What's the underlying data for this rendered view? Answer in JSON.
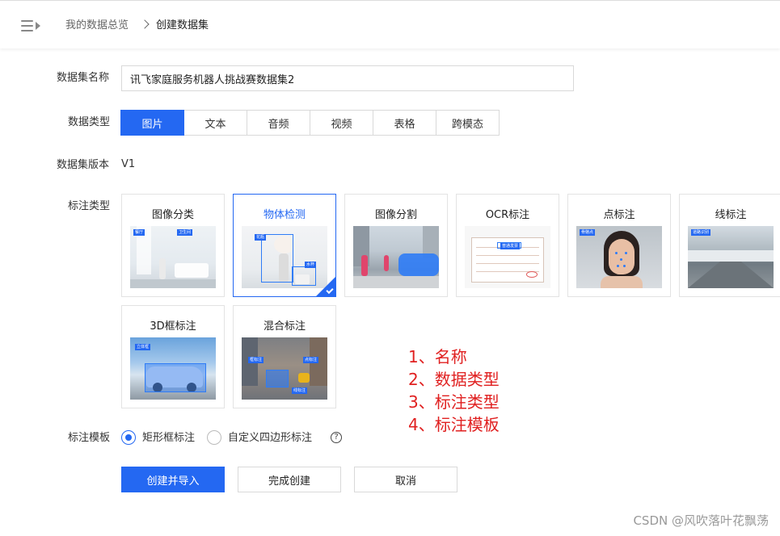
{
  "header": {
    "breadcrumb_parent": "我的数据总览",
    "breadcrumb_current": "创建数据集"
  },
  "form": {
    "name_label": "数据集名称",
    "name_value": "讯飞家庭服务机器人挑战赛数据集2",
    "type_label": "数据类型",
    "types": [
      "图片",
      "文本",
      "音频",
      "视频",
      "表格",
      "跨模态"
    ],
    "version_label": "数据集版本",
    "version_value": "V1",
    "annotation_label": "标注类型",
    "annotation_types": [
      {
        "title": "图像分类",
        "tags": [
          "餐厅",
          "卫生间"
        ]
      },
      {
        "title": "物体检测",
        "tags": [
          "花瓶",
          "水杯"
        ]
      },
      {
        "title": "图像分割",
        "tags": []
      },
      {
        "title": "OCR标注",
        "tags": [
          "普通发票"
        ]
      },
      {
        "title": "点标注",
        "tags": [
          "骨骼点"
        ]
      },
      {
        "title": "线标注",
        "tags": [
          "道路识别"
        ]
      },
      {
        "title": "3D框标注",
        "tags": [
          "立体框"
        ]
      },
      {
        "title": "混合标注",
        "tags": [
          "框标注",
          "点标注",
          "线标注"
        ]
      }
    ],
    "template_label": "标注模板",
    "template_options": [
      "矩形框标注",
      "自定义四边形标注"
    ],
    "help_symbol": "?"
  },
  "buttons": {
    "create_import": "创建并导入",
    "finish": "完成创建",
    "cancel": "取消"
  },
  "annotations": [
    "1、名称",
    "2、数据类型",
    "3、标注类型",
    "4、标注模板"
  ],
  "watermark": "CSDN @风吹落叶花飘荡",
  "colors": {
    "primary": "#2468f2",
    "annotation_red": "#e02020"
  }
}
